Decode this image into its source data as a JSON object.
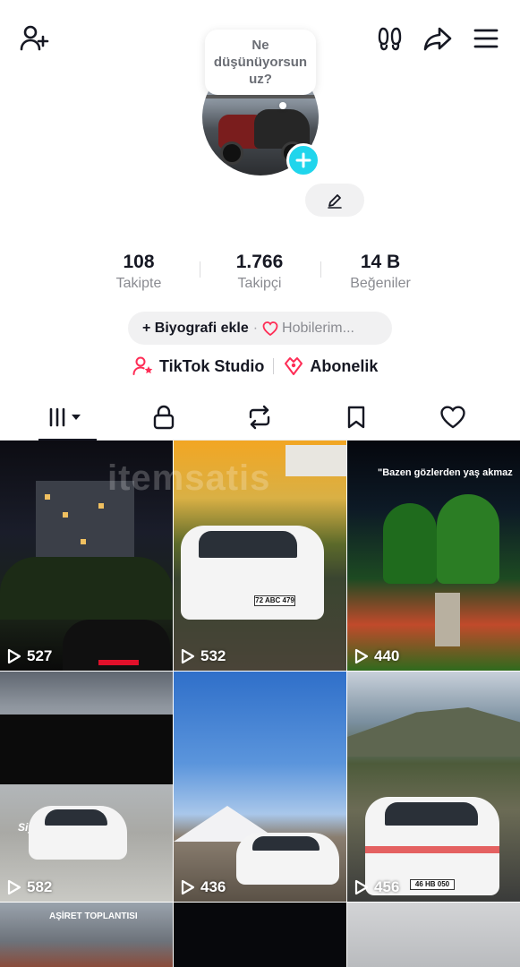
{
  "bubble": {
    "text": "Ne düşünüyorsun uz?"
  },
  "profile": {
    "username": ""
  },
  "stats": [
    {
      "value": "108",
      "label": "Takipte"
    },
    {
      "value": "1.766",
      "label": "Takipçi"
    },
    {
      "value": "14 B",
      "label": "Beğeniler"
    }
  ],
  "bio": {
    "add_label": "+ Biyografi ekle",
    "separator": "·",
    "hobbies_label": "Hobilerim..."
  },
  "links": {
    "studio": "TikTok Studio",
    "subscription": "Abonelik"
  },
  "icons": {
    "add_friend": "add-user-icon",
    "footprints": "footprints-icon",
    "share": "share-icon",
    "menu": "menu-icon",
    "edit": "pencil-icon",
    "plus": "plus-icon"
  },
  "tabs": [
    {
      "name": "videos",
      "icon": "grid-icon",
      "active": true
    },
    {
      "name": "private",
      "icon": "lock-icon",
      "active": false
    },
    {
      "name": "reposts",
      "icon": "repost-icon",
      "active": false
    },
    {
      "name": "favorites",
      "icon": "bookmark-icon",
      "active": false
    },
    {
      "name": "liked",
      "icon": "heart-icon",
      "active": false
    }
  ],
  "videos": [
    {
      "views": "527"
    },
    {
      "views": "532"
    },
    {
      "views": "440",
      "caption": "\"Bazen gözlerden yaş akmaz"
    },
    {
      "views": "582",
      "caption": "Siyah"
    },
    {
      "views": "436"
    },
    {
      "views": "456"
    },
    {
      "caption": "AŞİRET TOPLANTISI"
    },
    {},
    {}
  ],
  "plates": [
    "72 ABC 479",
    "46 HB 050"
  ],
  "watermark": "itemsatis",
  "colors": {
    "accent": "#fe2c55",
    "cyan": "#20d5ec",
    "text": "#161823",
    "muted": "#8a8b91",
    "pill": "#f1f1f2"
  }
}
